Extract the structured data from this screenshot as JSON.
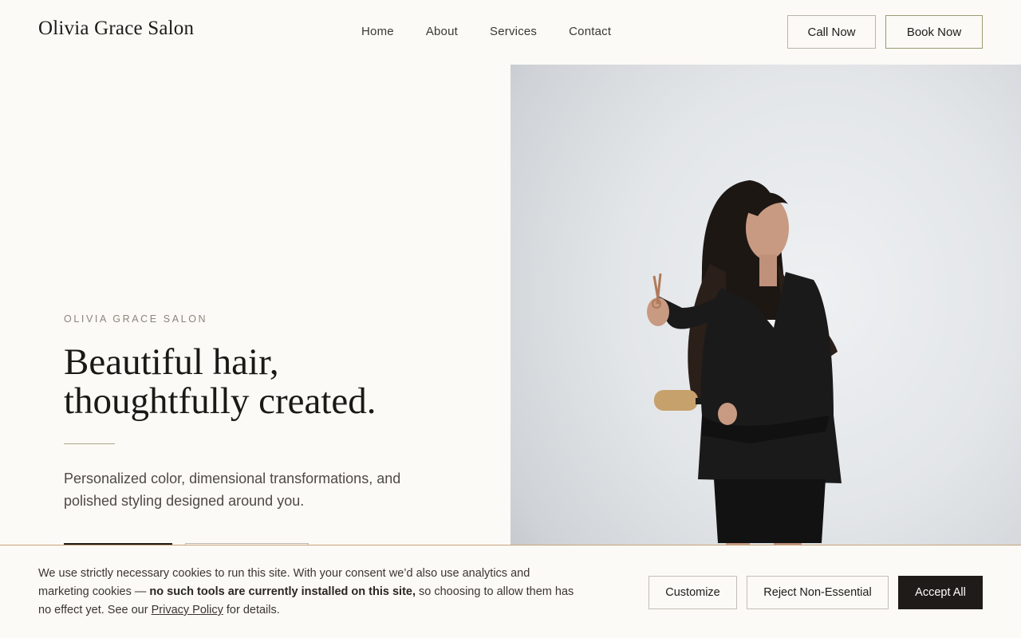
{
  "header": {
    "brand": "Olivia Grace Salon",
    "nav": [
      "Home",
      "About",
      "Services",
      "Contact"
    ],
    "call_label": "Call Now",
    "book_label": "Book Now"
  },
  "hero": {
    "eyebrow": "OLIVIA GRACE SALON",
    "headline_line1": "Beautiful hair,",
    "headline_line2": "thoughtfully created.",
    "subtext": "Personalized color, dimensional transformations, and polished styling designed around you."
  },
  "cookie": {
    "text_start": "We use strictly necessary cookies to run this site. With your consent we’d also use analytics and marketing cookies — ",
    "text_bold": "no such tools are currently installed on this site,",
    "text_mid": " so choosing to allow them has no effect yet. See our ",
    "link_label": "Privacy Policy",
    "text_end": " for details.",
    "customize_label": "Customize",
    "reject_label": "Reject Non-Essential",
    "accept_label": "Accept All"
  },
  "colors": {
    "background": "#fcfaf6",
    "primary_dark": "#1e1b18",
    "accent_olive": "#9a9a72",
    "banner_border": "#c9a27a"
  }
}
